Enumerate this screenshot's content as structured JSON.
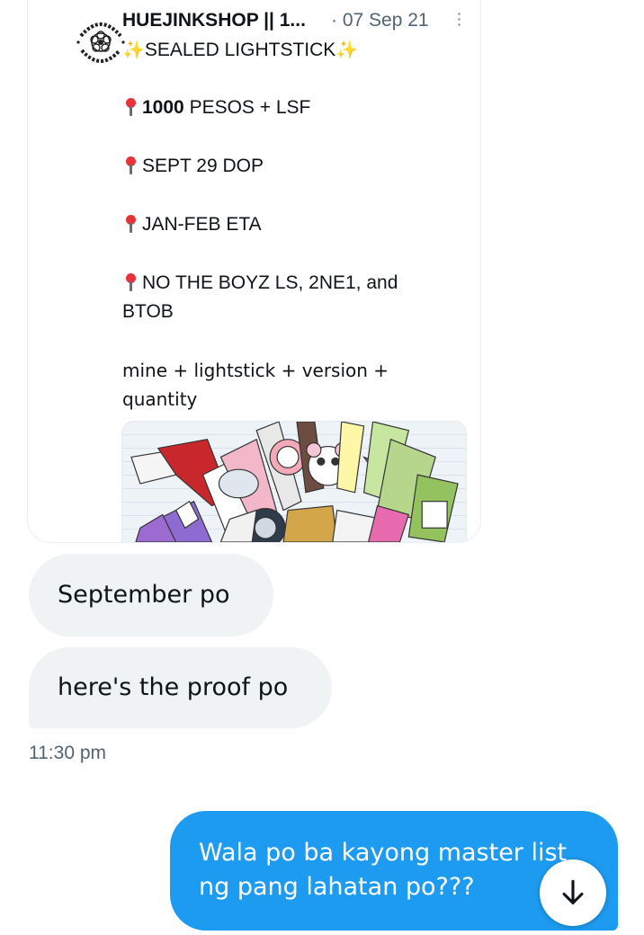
{
  "quoted_tweet": {
    "author": "HUEJINKSHOP || 1...",
    "date": "· 07 Sep 21",
    "avatar_text": "HUEJINK SHOP",
    "title": "SEALED LIGHTSTICK",
    "title_icon": "sparkles",
    "bullets": [
      {
        "icon": "round-pushpin",
        "bold": "1000",
        "text": "PESOS + LSF"
      },
      {
        "icon": "round-pushpin",
        "bold": "",
        "text": "SEPT 29 DOP"
      },
      {
        "icon": "round-pushpin",
        "bold": "",
        "text": "JAN-FEB ETA"
      },
      {
        "icon": "round-pushpin",
        "bold": "",
        "text": "NO THE BOYZ LS, 2NE1, and",
        "text_2": "BTOB"
      }
    ],
    "note_line_1": "mine + lightstick + version +",
    "note_line_2": "quantity",
    "media": "lightsticks-collage-image"
  },
  "messages": {
    "incoming": [
      {
        "text": "September po"
      },
      {
        "text": "here's the proof po"
      }
    ],
    "incoming_time": "11:30 pm",
    "outgoing": {
      "line_1": "Wala po ba kayong master list",
      "line_2": "ng pang lahatan po???"
    }
  },
  "controls": {
    "scroll_down_icon": "arrow-down-icon"
  },
  "colors": {
    "outgoing_bubble": "#1d9bf0",
    "incoming_bubble": "#eff3f4",
    "secondary_text": "#536471",
    "pin_red": "#e8323a",
    "sparkle_yellow": "#f5c400"
  }
}
